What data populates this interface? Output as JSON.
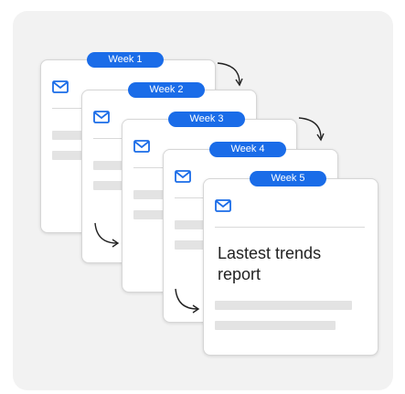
{
  "colors": {
    "accent": "#1a6ce8",
    "background": "#f2f2f2",
    "card": "#ffffff",
    "placeholder": "#e3e3e3"
  },
  "cards": [
    {
      "badge": "Week 1",
      "icon": "mail-icon",
      "text": ""
    },
    {
      "badge": "Week 2",
      "icon": "mail-icon",
      "text": ""
    },
    {
      "badge": "Week 3",
      "icon": "mail-icon",
      "text": ""
    },
    {
      "badge": "Week 4",
      "icon": "mail-icon",
      "text": ""
    },
    {
      "badge": "Week 5",
      "icon": "mail-icon",
      "text": "Lastest trends report"
    }
  ]
}
